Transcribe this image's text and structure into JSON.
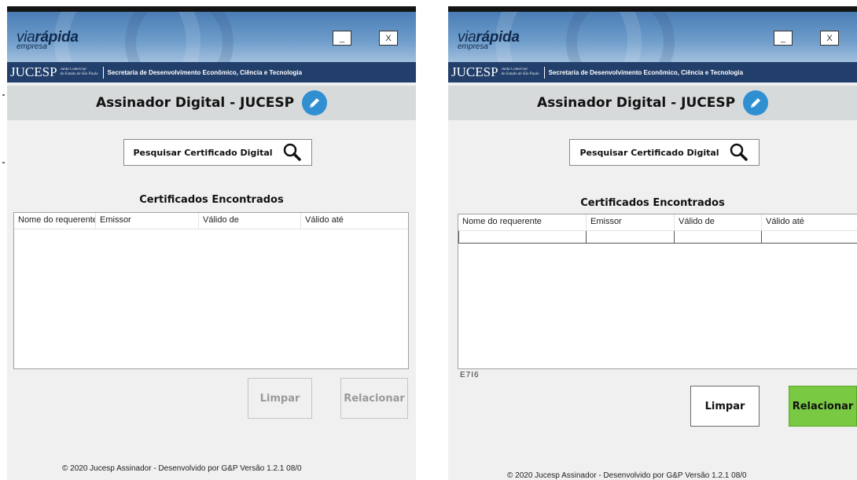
{
  "left_window": {
    "logo": {
      "main_light": "via",
      "main_bold": "rápida",
      "sub": "empresa"
    },
    "window_buttons": {
      "minimize": "_",
      "close": "X"
    },
    "org_bar": {
      "name": "JUCESP",
      "junta_line1": "Junta Comercial",
      "junta_line2": "do Estado de São Paulo",
      "secretaria": "Secretaria de Desenvolvimento Econômico, Ciência e Tecnologia"
    },
    "title": "Assinador Digital - JUCESP",
    "search_button": "Pesquisar Certificado Digital",
    "list_title": "Certificados Encontrados",
    "table_headers": [
      "Nome do requerente",
      "Emissor",
      "Válido de",
      "Válido até"
    ],
    "buttons": {
      "limpar": "Limpar",
      "relacionar": "Relacionar"
    },
    "footer": "© 2020 Jucesp Assinador - Desenvolvido por G&P Versão  1.2.1     08/0"
  },
  "right_window": {
    "logo": {
      "main_light": "via",
      "main_bold": "rápida",
      "sub": "empresa"
    },
    "window_buttons": {
      "minimize": "_",
      "close": "X"
    },
    "org_bar": {
      "name": "JUCESP",
      "junta_line1": "Junta Comercial",
      "junta_line2": "do Estado de São Paulo",
      "secretaria": "Secretaria de Desenvolvimento Econômico, Ciência e Tecnologia"
    },
    "title": "Assinador Digital - JUCESP",
    "search_button": "Pesquisar Certificado Digital",
    "list_title": "Certificados Encontrados",
    "table_headers": [
      "Nome do requerente",
      "Emissor",
      "Válido de",
      "Válido até"
    ],
    "code": "E7I6",
    "buttons": {
      "limpar": "Limpar",
      "relacionar": "Relacionar"
    },
    "footer": "© 2020 Jucesp Assinador - Desenvolvido por G&P Versão  1.2.1     08/0"
  },
  "colors": {
    "banner": "#5a8cc2",
    "org_bar": "#223f6b",
    "title_bar": "#d7dadb",
    "pencil_icon": "#2f8fd0",
    "relacionar_active": "#7ac943"
  }
}
